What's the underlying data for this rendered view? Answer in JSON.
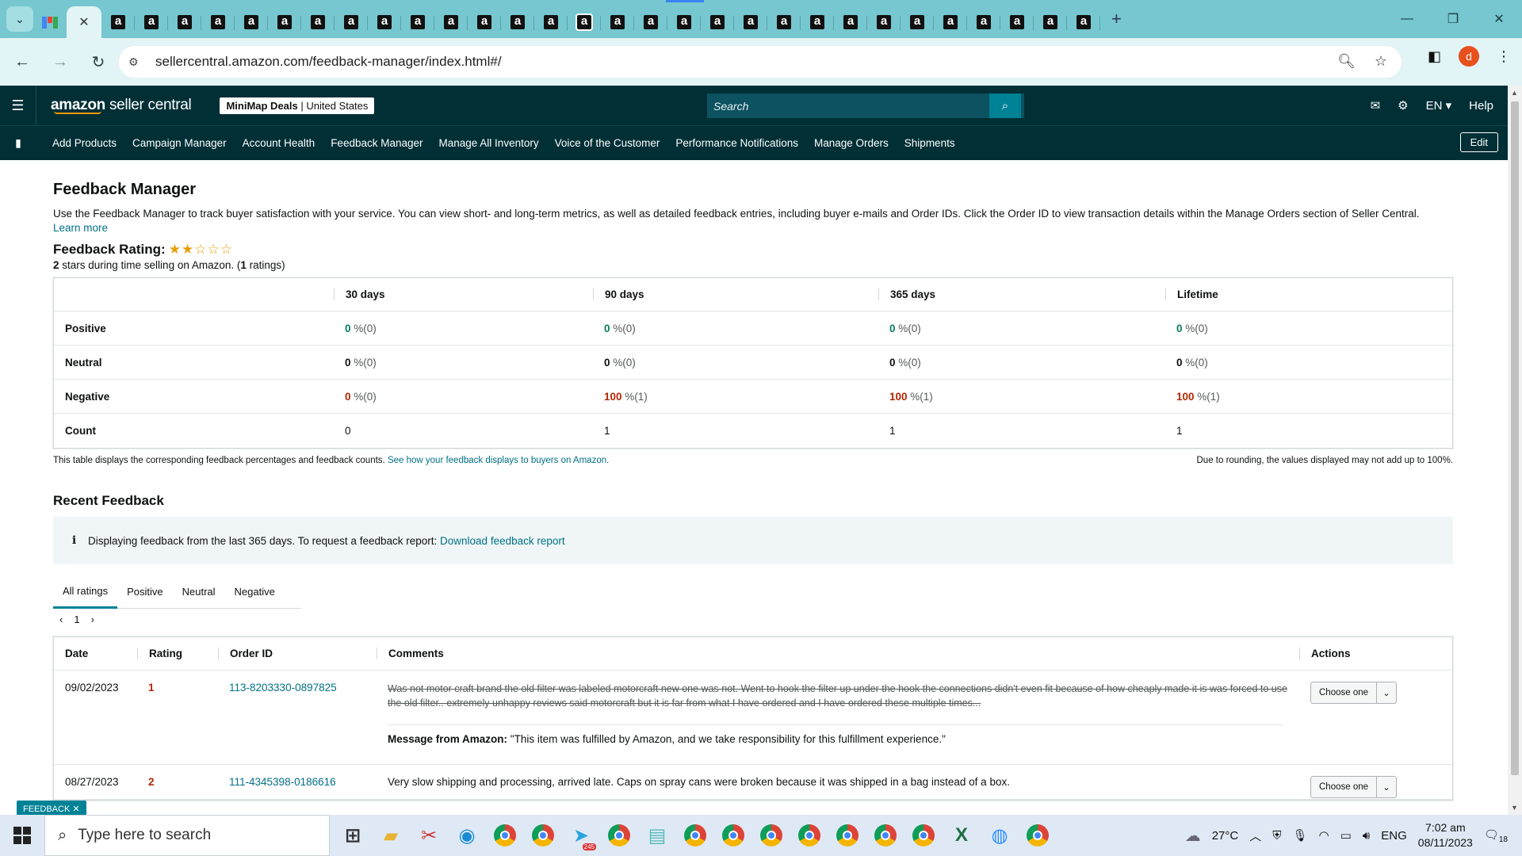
{
  "browser": {
    "active_tab_close": "✕",
    "amazon_tab_glyph": "a",
    "amazon_tab_count": 30,
    "new_tab": "+",
    "url": "sellercentral.amazon.com/feedback-manager/index.html#/",
    "profile_initial": "d"
  },
  "header": {
    "logo_main": "amazon",
    "logo_sub": "seller central",
    "store_name": "MiniMap Deals",
    "store_sep": " | ",
    "store_region": "United States",
    "search_placeholder": "Search",
    "lang": "EN",
    "help": "Help"
  },
  "nav": {
    "links": [
      "Add Products",
      "Campaign Manager",
      "Account Health",
      "Feedback Manager",
      "Manage All Inventory",
      "Voice of the Customer",
      "Performance Notifications",
      "Manage Orders",
      "Shipments"
    ],
    "edit": "Edit"
  },
  "page": {
    "title": "Feedback Manager",
    "intro": "Use the Feedback Manager to track buyer satisfaction with your service. You can view short- and long-term metrics, as well as detailed feedback entries, including buyer e-mails and Order IDs. Click the Order ID to view transaction details within the Manage Orders section of Seller Central.",
    "learn_more": "Learn more",
    "rating_label": "Feedback Rating:",
    "rating_value": 2,
    "rating_max": 5,
    "rating_stars_text": "2",
    "rating_sub_mid": " stars during time selling on Amazon. (",
    "rating_count": "1",
    "rating_sub_end": " ratings)"
  },
  "feedback_table": {
    "headers": [
      "",
      "30 days",
      "90 days",
      "365 days",
      "Lifetime"
    ],
    "rows": [
      {
        "label": "Positive",
        "cells": [
          {
            "v": "0",
            "c": "g",
            "s": "%(0)"
          },
          {
            "v": "0",
            "c": "g",
            "s": "%(0)"
          },
          {
            "v": "0",
            "c": "g",
            "s": "%(0)"
          },
          {
            "v": "0",
            "c": "g",
            "s": "%(0)"
          }
        ]
      },
      {
        "label": "Neutral",
        "cells": [
          {
            "v": "0",
            "c": "z",
            "s": "%(0)"
          },
          {
            "v": "0",
            "c": "z",
            "s": "%(0)"
          },
          {
            "v": "0",
            "c": "z",
            "s": "%(0)"
          },
          {
            "v": "0",
            "c": "z",
            "s": "%(0)"
          }
        ]
      },
      {
        "label": "Negative",
        "cells": [
          {
            "v": "0",
            "c": "r",
            "s": "%(0)"
          },
          {
            "v": "100",
            "c": "r",
            "s": "%(1)"
          },
          {
            "v": "100",
            "c": "r",
            "s": "%(1)"
          },
          {
            "v": "100",
            "c": "r",
            "s": "%(1)"
          }
        ]
      },
      {
        "label": "Count",
        "cells": [
          {
            "v": "0",
            "c": "",
            "s": ""
          },
          {
            "v": "1",
            "c": "",
            "s": ""
          },
          {
            "v": "1",
            "c": "",
            "s": ""
          },
          {
            "v": "1",
            "c": "",
            "s": ""
          }
        ]
      }
    ],
    "note_left": "This table displays the corresponding feedback percentages and feedback counts.",
    "note_link": "See how your feedback displays to buyers on Amazon.",
    "note_right": "Due to rounding, the values displayed may not add up to 100%."
  },
  "recent": {
    "title": "Recent Feedback",
    "info_icon": "i",
    "info_text": "Displaying feedback from the last 365 days. To request a feedback report:",
    "info_link": "Download feedback report",
    "tabs": [
      "All ratings",
      "Positive",
      "Neutral",
      "Negative"
    ],
    "page_num": "1",
    "headers": [
      "Date",
      "Rating",
      "Order ID",
      "Comments",
      "Actions"
    ],
    "rows": [
      {
        "date": "09/02/2023",
        "rating": "1",
        "order_id": "113-8203330-0897825",
        "comment": "Was not motor craft brand the old filter was labeled motorcraft new one was not. Went to hook the filter up under the hook the connections didn't even fit because of how cheaply made it is was forced to use the old filter.. extremely unhappy reviews said motorcraft but it is far from what I have ordered and I have ordered these multiple times...",
        "msg_label": "Message from Amazon:",
        "msg_text": "\"This item was fulfilled by Amazon, and we take responsibility for this fulfillment experience.\"",
        "action": "Choose one"
      },
      {
        "date": "08/27/2023",
        "rating": "2",
        "order_id": "111-4345398-0186616",
        "comment": "Very slow shipping and processing, arrived late. Caps on spray cans were broken because it was shipped in a bag instead of a box.",
        "action": "Choose one"
      }
    ],
    "feedback_tag": "FEEDBACK ✕"
  },
  "taskbar": {
    "search_placeholder": "Type here to search",
    "temp": "27°C",
    "lang": "ENG",
    "time": "7:02 am",
    "date": "08/11/2023",
    "notif_count": "18",
    "weather_badge": "1",
    "telegram_badge": "245"
  },
  "colors": {
    "header_bg": "#002f36",
    "tab_strip": "#76c7cf",
    "link": "#007185",
    "positive": "#067d62",
    "negative": "#b12704",
    "star": "#e5a00d"
  }
}
